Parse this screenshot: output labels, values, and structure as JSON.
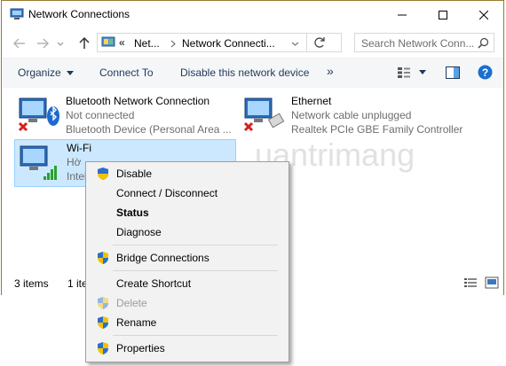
{
  "window": {
    "title": "Network Connections",
    "icons": {
      "minimize": "minimize-icon",
      "maximize": "maximize-icon",
      "close": "close-icon"
    }
  },
  "address": {
    "prefix": "«",
    "segment1": "Net...",
    "segment2": "Network Connecti...",
    "search_placeholder": "Search Network Conn..."
  },
  "toolbar": {
    "organize": "Organize",
    "connect_to": "Connect To",
    "disable": "Disable this network device",
    "more": "»"
  },
  "connections": [
    {
      "name": "Bluetooth Network Connection",
      "status": "Not connected",
      "device": "Bluetooth Device (Personal Area ..."
    },
    {
      "name": "Ethernet",
      "status": "Network cable unplugged",
      "device": "Realtek PCIe GBE Family Controller"
    },
    {
      "name": "Wi-Fi",
      "status": "Hờ ..",
      "device": "Intel"
    }
  ],
  "status_bar": {
    "items_count": "3 items",
    "selected": "1 ite"
  },
  "context_menu": {
    "items": [
      {
        "label": "Disable",
        "shield": true,
        "bold": false,
        "disabled": false
      },
      {
        "label": "Connect / Disconnect",
        "shield": false,
        "bold": false,
        "disabled": false
      },
      {
        "label": "Status",
        "shield": false,
        "bold": true,
        "disabled": false
      },
      {
        "label": "Diagnose",
        "shield": false,
        "bold": false,
        "disabled": false
      },
      {
        "label": "Bridge Connections",
        "shield": true,
        "bold": false,
        "disabled": false
      },
      {
        "label": "Create Shortcut",
        "shield": false,
        "bold": false,
        "disabled": false
      },
      {
        "label": "Delete",
        "shield": true,
        "bold": false,
        "disabled": true
      },
      {
        "label": "Rename",
        "shield": true,
        "bold": false,
        "disabled": false
      },
      {
        "label": "Properties",
        "shield": true,
        "bold": false,
        "disabled": false
      }
    ]
  },
  "watermark": "uantrimang",
  "colors": {
    "accent": "#1e395b",
    "selection": "#cce8ff",
    "border": "#9a7a2e"
  }
}
